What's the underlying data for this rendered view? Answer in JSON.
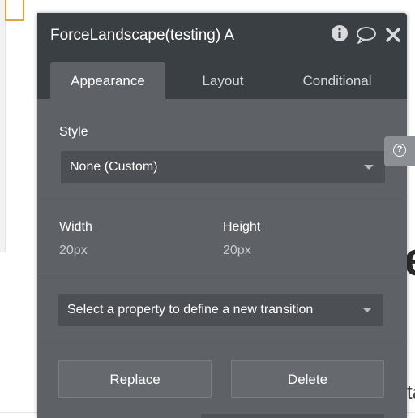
{
  "element_editor": {
    "title": "ForceLandscape(testing) A",
    "tabs": [
      {
        "label": "Appearance",
        "active": true
      },
      {
        "label": "Layout",
        "active": false
      },
      {
        "label": "Conditional",
        "active": false
      }
    ],
    "style": {
      "label": "Style",
      "selected": "None (Custom)"
    },
    "width": {
      "label": "Width",
      "value": "20px"
    },
    "height": {
      "label": "Height",
      "value": "20px"
    },
    "transition": {
      "placeholder": "Select a property to define a new transition"
    },
    "buttons": {
      "replace": "Replace",
      "delete": "Delete"
    }
  },
  "help": {
    "glyph": "?"
  },
  "background": {
    "large_letter": "e",
    "small_letter": "ta"
  },
  "colors": {
    "panel_bg": "#5e6266",
    "header_bg": "#3a3f44",
    "select_bg": "#4c5055",
    "accent_outline": "#f0a030"
  },
  "icons": [
    "info-icon",
    "comment-icon",
    "close-icon",
    "chevron-down-icon",
    "help-icon"
  ]
}
